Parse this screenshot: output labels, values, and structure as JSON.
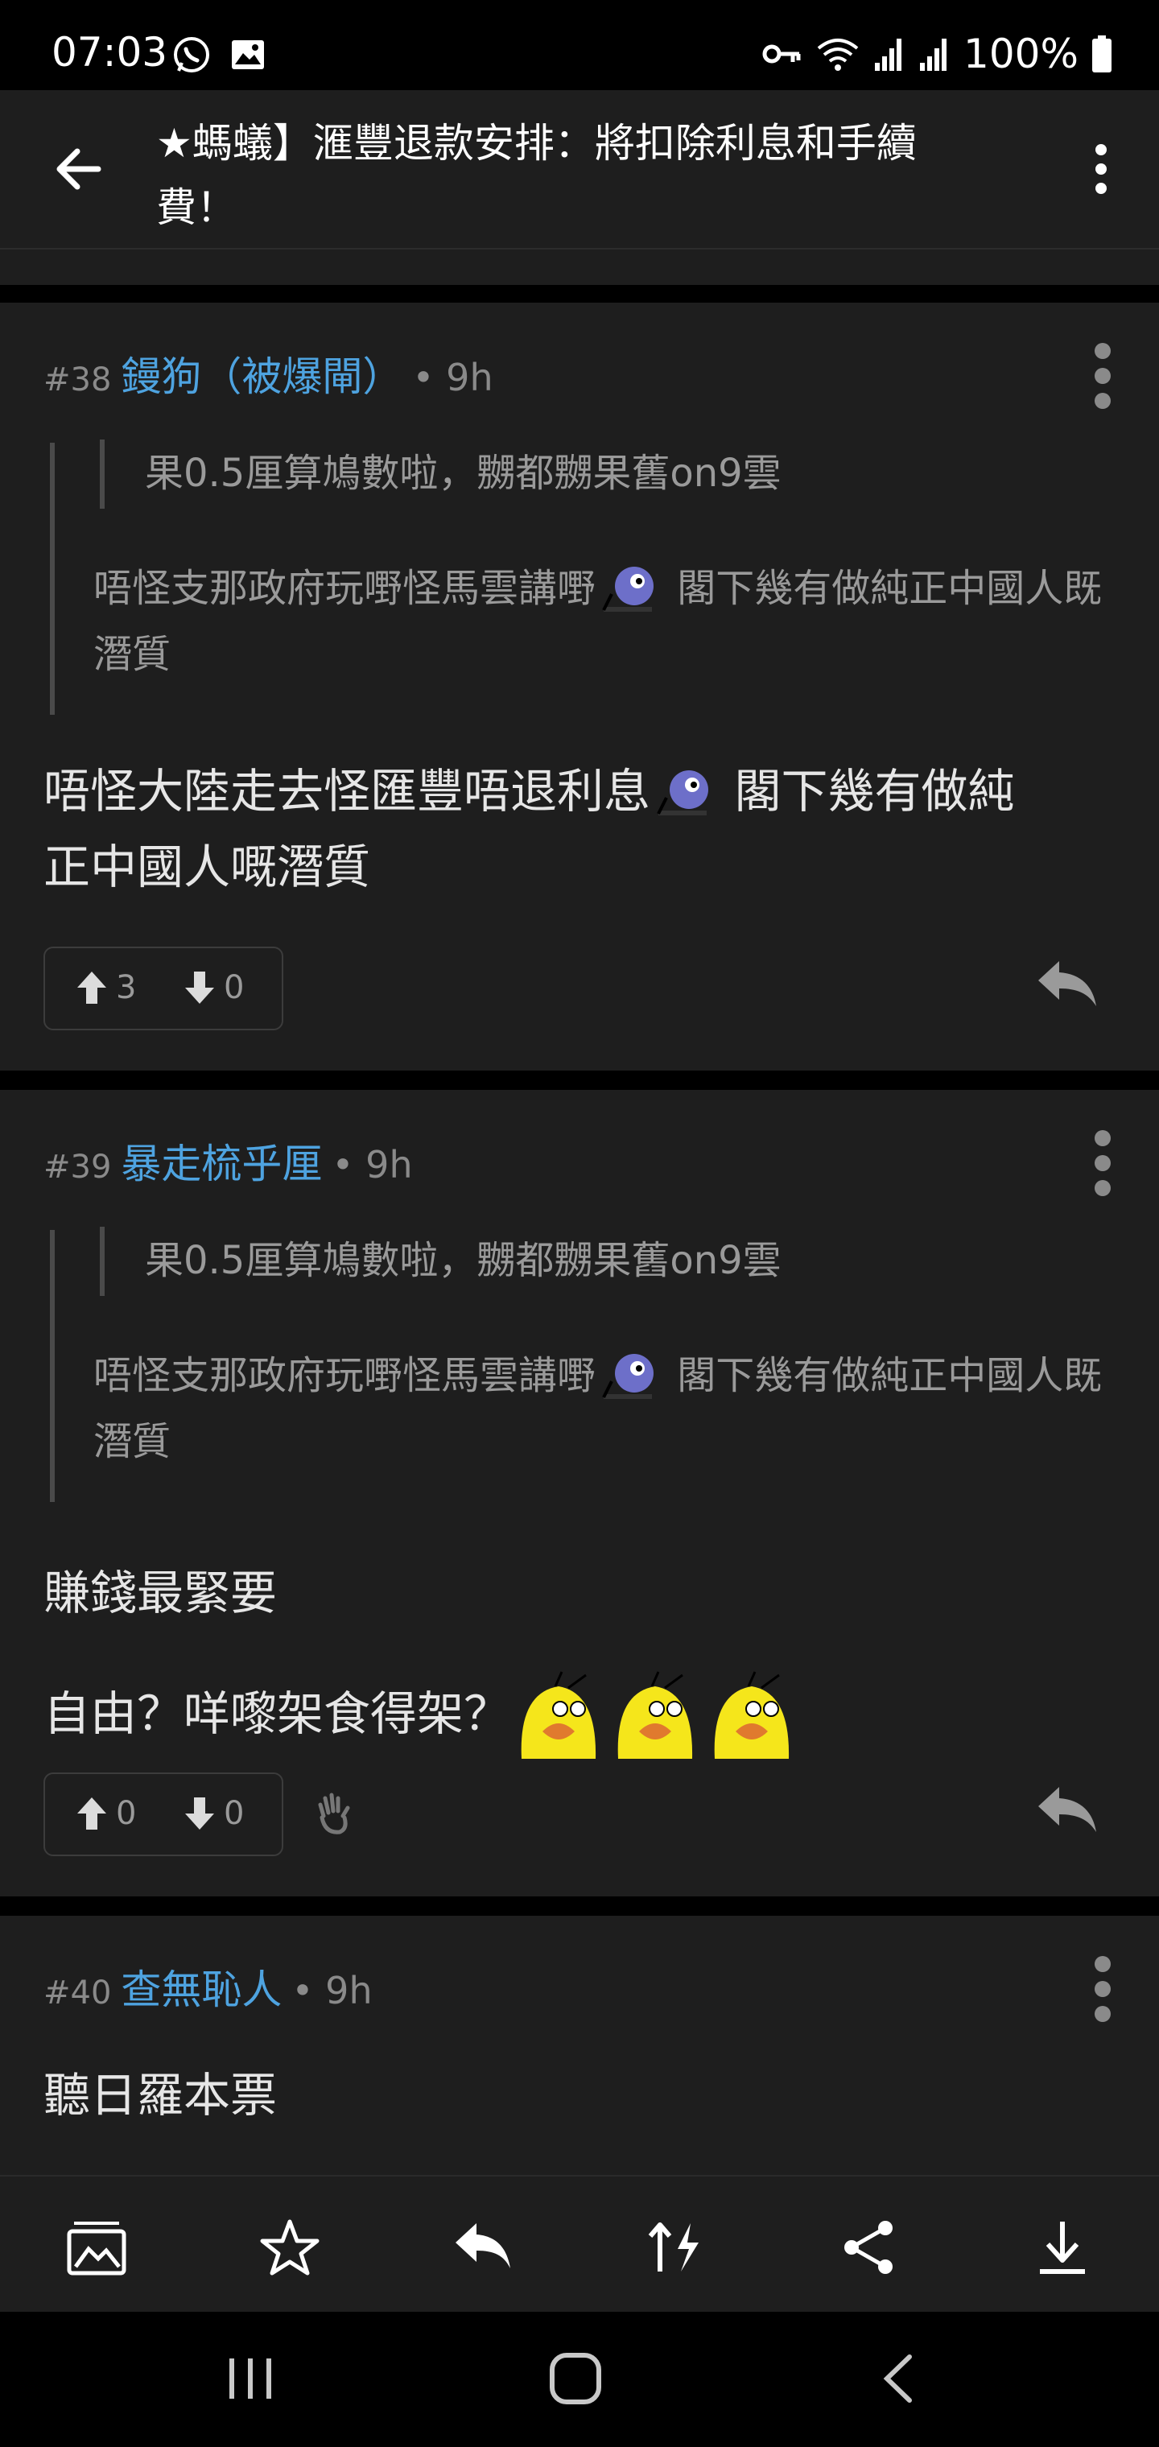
{
  "status_bar": {
    "time": "07:03",
    "battery": "100%",
    "icons": [
      "whatsapp-icon",
      "gallery-icon",
      "vpn-key-icon",
      "wifi-icon",
      "signal-icon",
      "signal-icon",
      "battery-icon"
    ]
  },
  "app_bar": {
    "title": "★螞蟻】滙豐退款安排：將扣除利息和手續費！",
    "back_icon": "arrow-left-icon",
    "menu_icon": "more-vertical-icon"
  },
  "posts": [
    {
      "number": "#38",
      "username": "鏝狗（被爆閘）",
      "time": "• 9h",
      "nested_quote": "果0.5厘算鳩數啦，嬲都嬲果舊on9雲",
      "quote": "唔怪支那政府玩嘢怪馬雲講嘢",
      "quote_tail": "閣下幾有做純正中國人既潛質",
      "body_line1": "唔怪大陸走去怪匯豐唔退利息",
      "body_line1_tail": "閣下幾有做純",
      "body_line2": "正中國人嘅潛質",
      "upvotes": "3",
      "downvotes": "0"
    },
    {
      "number": "#39",
      "username": "暴走梳乎厘",
      "time": "• 9h",
      "nested_quote": "果0.5厘算鳩數啦，嬲都嬲果舊on9雲",
      "quote": "唔怪支那政府玩嘢怪馬雲講嘢",
      "quote_tail": "閣下幾有做純正中國人既潛質",
      "body_line1": "賺錢最緊要",
      "body_line2": "自由？咩嚟架食得架？",
      "upvotes": "0",
      "downvotes": "0"
    },
    {
      "number": "#40",
      "username": "查無恥人",
      "time": "• 9h",
      "body_line1": "聽日羅本票"
    }
  ],
  "bottom_bar": {
    "icons": [
      "gallery-icon",
      "star-icon",
      "reply-icon",
      "sort-icon",
      "share-icon",
      "download-icon"
    ]
  },
  "nav_bar": {
    "icons": [
      "recent-apps-icon",
      "home-icon",
      "back-icon"
    ]
  },
  "colors": {
    "background": "#000000",
    "surface": "#1e1e1e",
    "username": "#4ea3e0",
    "meta": "#8a8a8a",
    "quote_text": "#9a9a9a",
    "body_text": "#e6e6e6"
  }
}
